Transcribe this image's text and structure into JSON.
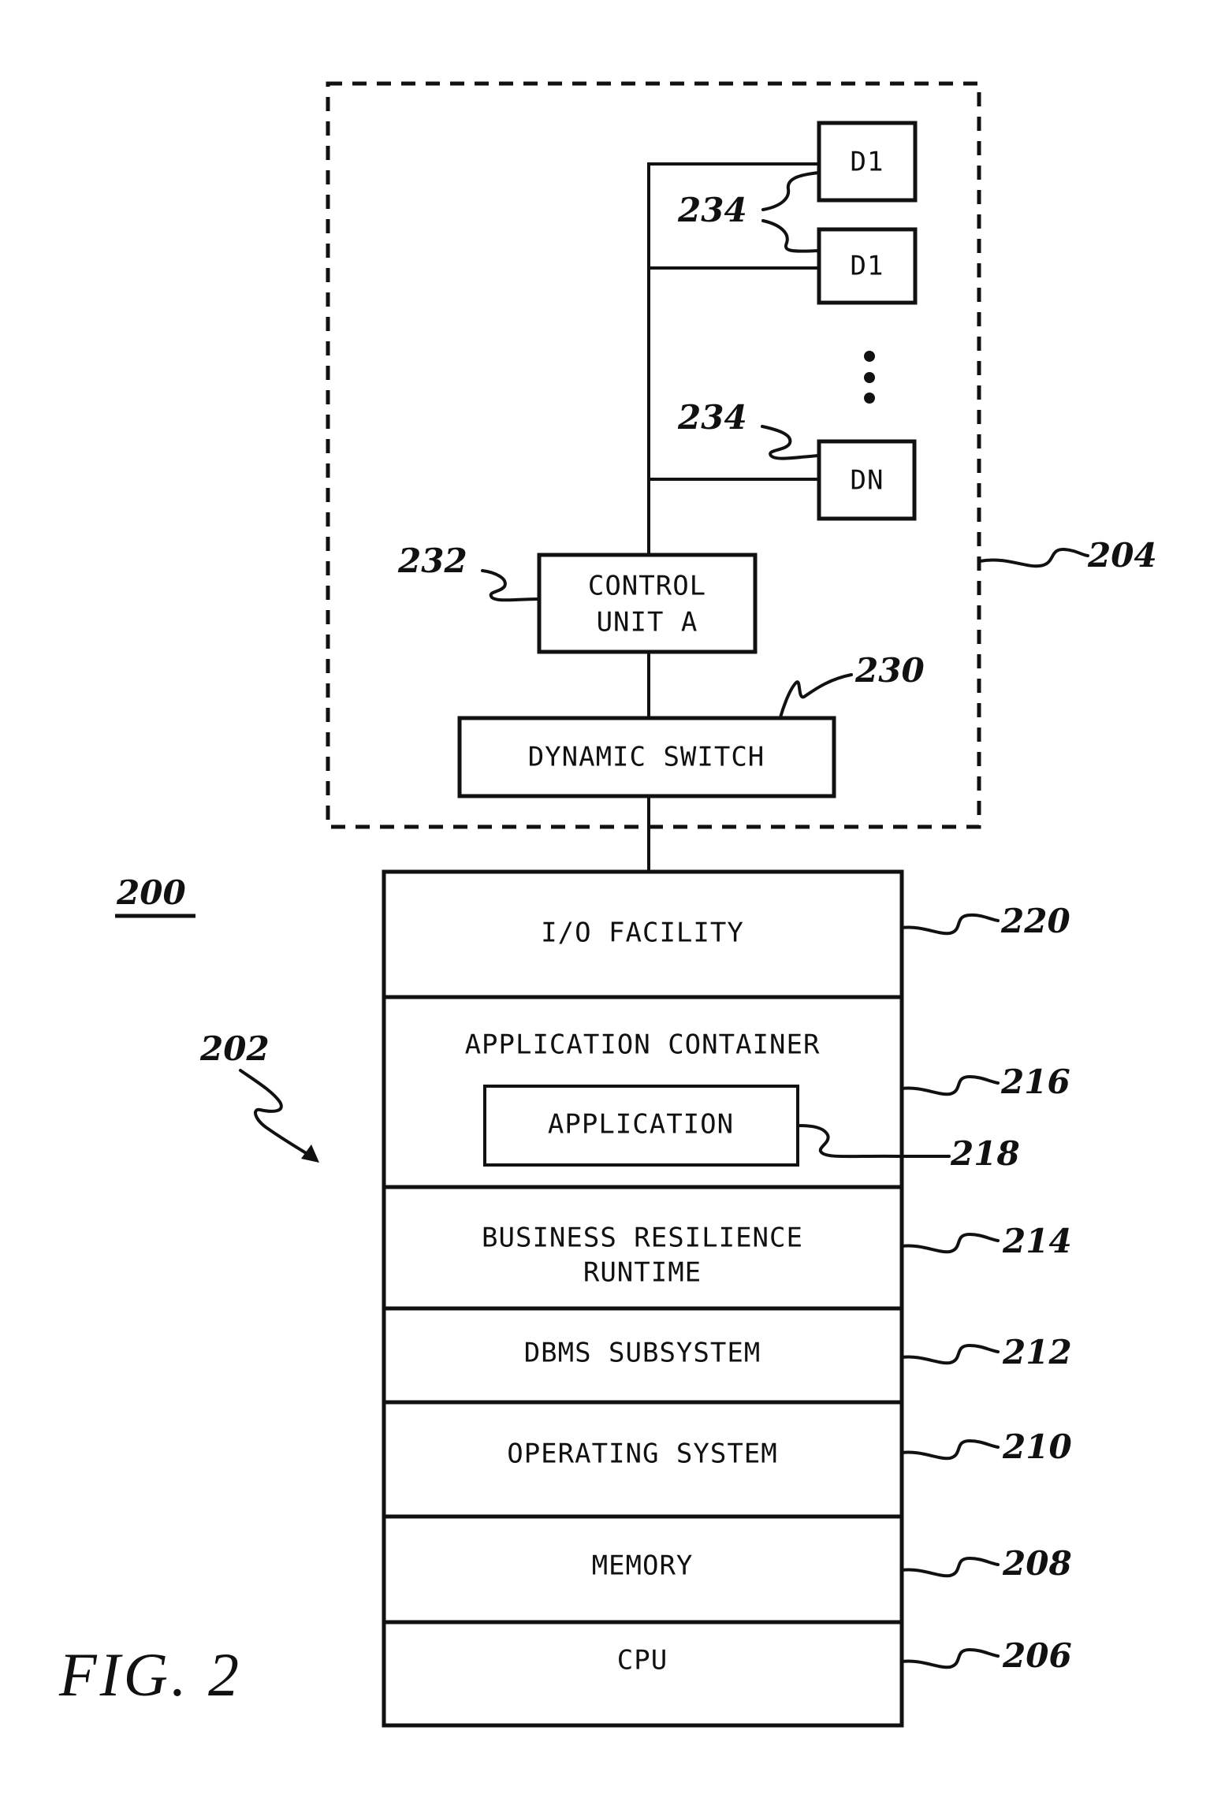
{
  "figure": {
    "caption": "FIG. 2",
    "system_ref": "200",
    "computer_ref": "202"
  },
  "storage_subsystem": {
    "ref": "204",
    "devices": [
      {
        "label": "D1",
        "ref": "234"
      },
      {
        "label": "D1",
        "ref": ""
      },
      {
        "label": "DN",
        "ref": "234"
      }
    ],
    "ellipsis": "⋮",
    "control_unit": {
      "line1": "CONTROL",
      "line2": "UNIT A",
      "ref": "232"
    },
    "dynamic_switch": {
      "label": "DYNAMIC SWITCH",
      "ref": "230"
    }
  },
  "stack": {
    "layers": [
      {
        "label": "I/O FACILITY",
        "ref": "220"
      },
      {
        "label": "APPLICATION CONTAINER",
        "ref": "216",
        "inner": {
          "label": "APPLICATION",
          "ref": "218"
        }
      },
      {
        "label": "BUSINESS RESILIENCE",
        "label2": "RUNTIME",
        "ref": "214"
      },
      {
        "label": "DBMS SUBSYSTEM",
        "ref": "212"
      },
      {
        "label": "OPERATING SYSTEM",
        "ref": "210"
      },
      {
        "label": "MEMORY",
        "ref": "208"
      },
      {
        "label": "CPU",
        "ref": "206"
      }
    ]
  }
}
